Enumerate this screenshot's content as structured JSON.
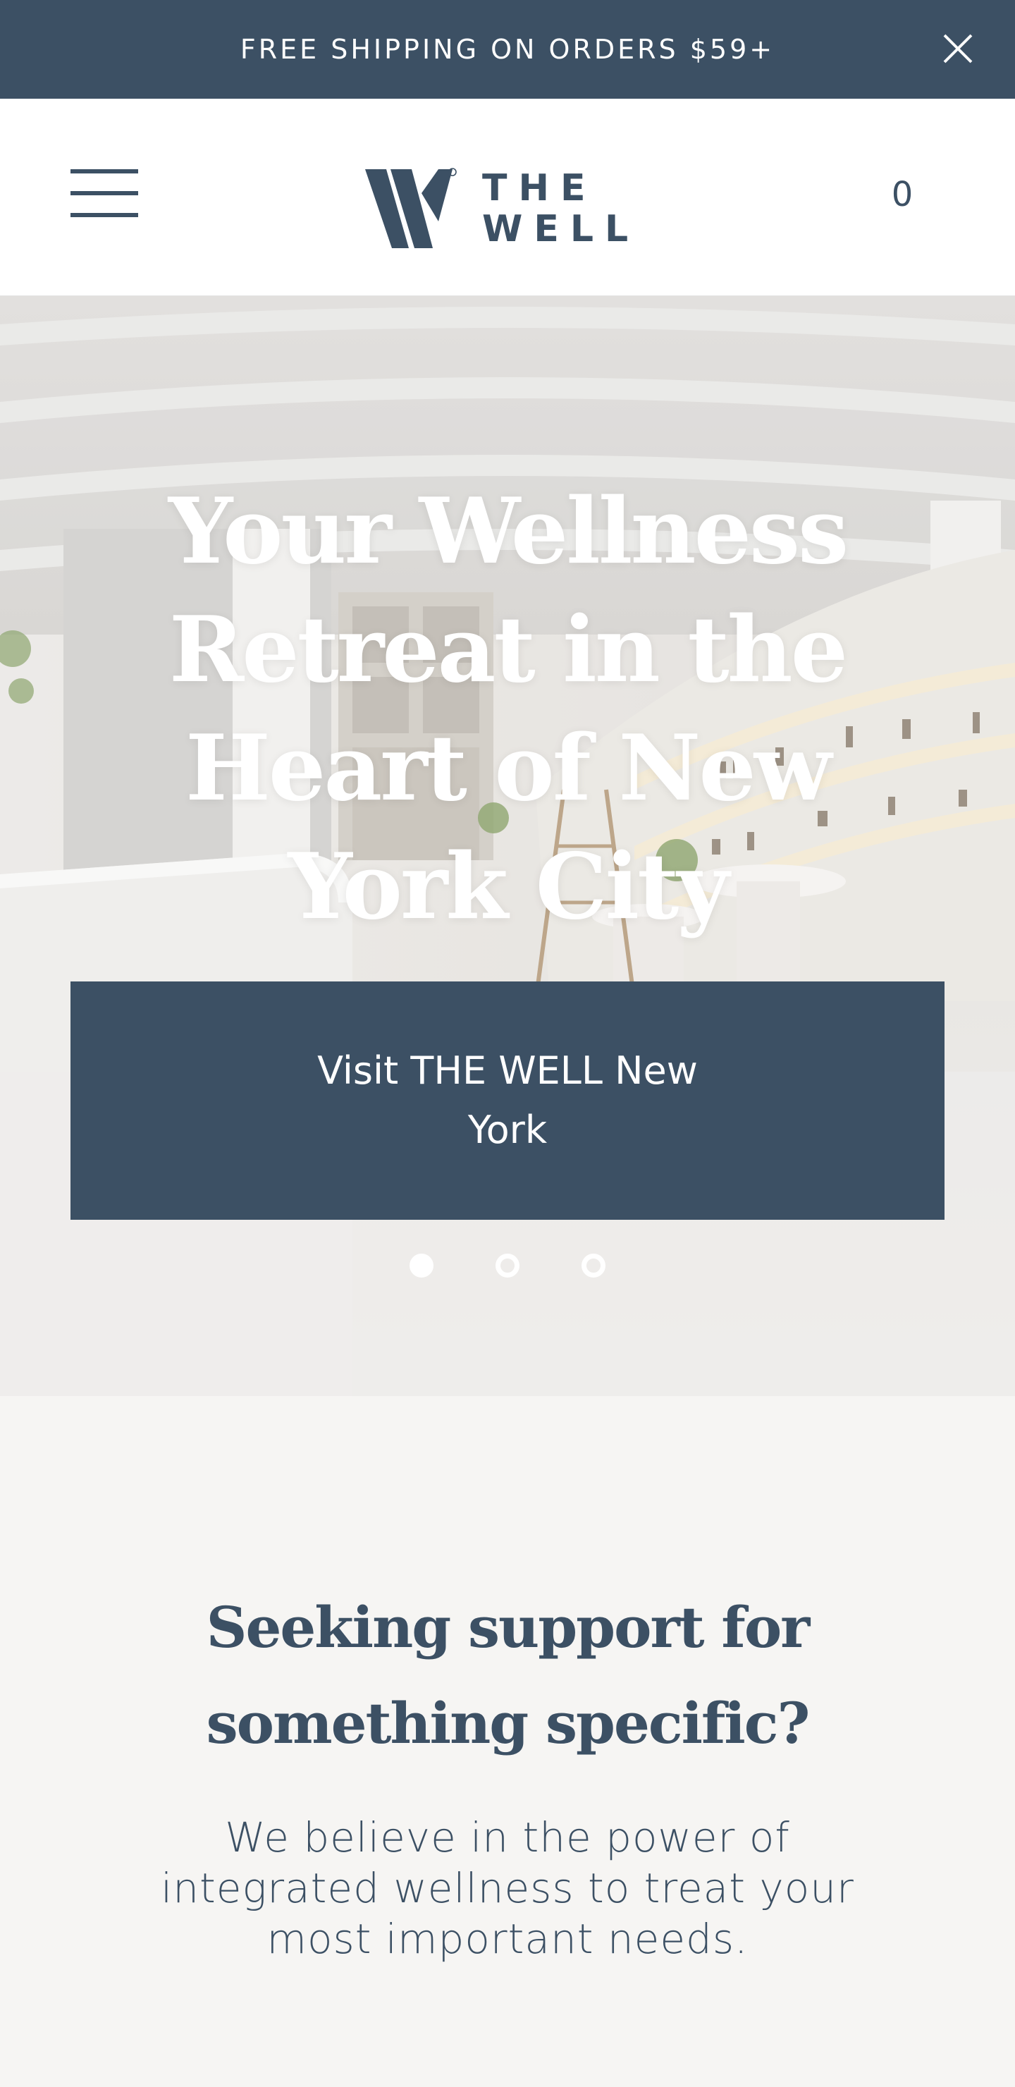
{
  "announcement": {
    "text": "FREE SHIPPING ON ORDERS $59+",
    "close_icon": "close-icon"
  },
  "header": {
    "menu_icon": "hamburger-menu-icon",
    "logo": {
      "line1": "THE",
      "line2": "WELL"
    },
    "cart_count": "0"
  },
  "hero": {
    "title": "Your Wellness Retreat in the Heart of New York City",
    "cta_label": "Visit THE WELL New York",
    "slides": 3,
    "active_slide": 1
  },
  "support": {
    "title": "Seeking support for something specific?",
    "body": "We believe in the power of integrated wellness to treat your most important needs."
  },
  "colors": {
    "brand_navy": "#3c5064",
    "background": "#f6f5f3",
    "white": "#ffffff"
  }
}
